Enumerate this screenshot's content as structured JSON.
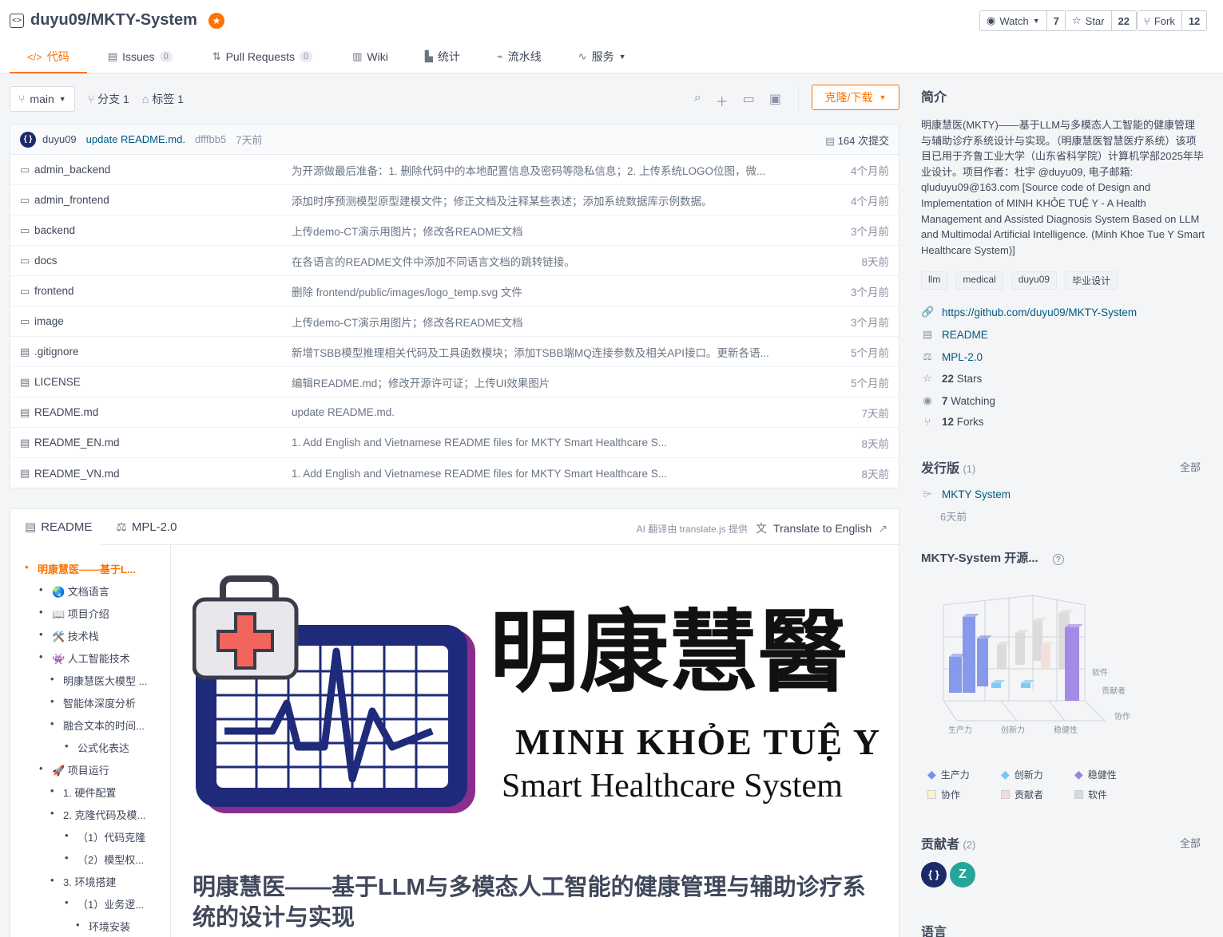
{
  "repo": {
    "title": "duyu09/MKTY-System"
  },
  "actions": {
    "watch_label": "Watch",
    "watch_count": "7",
    "star_label": "Star",
    "star_count": "22",
    "fork_label": "Fork",
    "fork_count": "12"
  },
  "tabs": [
    {
      "label": "代码",
      "icon": "code-icon"
    },
    {
      "label": "Issues",
      "icon": "issues-icon",
      "count": "0"
    },
    {
      "label": "Pull Requests",
      "icon": "pull-request-icon",
      "count": "0"
    },
    {
      "label": "Wiki",
      "icon": "wiki-icon"
    },
    {
      "label": "统计",
      "icon": "chart-icon"
    },
    {
      "label": "流水线",
      "icon": "pipeline-icon"
    },
    {
      "label": "服务",
      "icon": "service-icon"
    }
  ],
  "branchbar": {
    "branch": "main",
    "branches": "分支 1",
    "tags": "标签 1",
    "clone": "克隆/下载"
  },
  "commit": {
    "author": "duyu09",
    "message": "update README.md.",
    "sha": "dfffbb5",
    "time": "7天前",
    "total": "164 次提交"
  },
  "files": [
    {
      "name": "admin_backend",
      "type": "folder",
      "message": "为开源做最后准备：1. 删除代码中的本地配置信息及密码等隐私信息；2. 上传系统LOGO位图，微...",
      "time": "4个月前"
    },
    {
      "name": "admin_frontend",
      "type": "folder",
      "message": "添加时序预测模型原型建模文件；修正文档及注释某些表述；添加系统数据库示例数据。",
      "time": "4个月前"
    },
    {
      "name": "backend",
      "type": "folder",
      "message": "上传demo-CT演示用图片；修改各README文档",
      "time": "3个月前"
    },
    {
      "name": "docs",
      "type": "folder",
      "message": "在各语言的README文件中添加不同语言文档的跳转链接。",
      "time": "8天前"
    },
    {
      "name": "frontend",
      "type": "folder",
      "message": "删除 frontend/public/images/logo_temp.svg 文件",
      "time": "3个月前"
    },
    {
      "name": "image",
      "type": "folder",
      "message": "上传demo-CT演示用图片；修改各README文档",
      "time": "3个月前"
    },
    {
      "name": ".gitignore",
      "type": "file",
      "message": "新增TSBB模型推理相关代码及工具函数模块；添加TSBB端MQ连接参数及相关API接口。更新各语...",
      "time": "5个月前"
    },
    {
      "name": "LICENSE",
      "type": "file",
      "message": "编辑README.md；修改开源许可证；上传UI效果图片",
      "time": "5个月前"
    },
    {
      "name": "README.md",
      "type": "file",
      "message": "update README.md.",
      "time": "7天前"
    },
    {
      "name": "README_EN.md",
      "type": "file",
      "message": "1. Add English and Vietnamese README files for MKTY Smart Healthcare S...",
      "time": "8天前"
    },
    {
      "name": "README_VN.md",
      "type": "file",
      "message": "1. Add English and Vietnamese README files for MKTY Smart Healthcare S...",
      "time": "8天前"
    }
  ],
  "readme": {
    "tab_readme": "README",
    "tab_license": "MPL-2.0",
    "ai_note": "AI 翻译由 translate.js 提供",
    "translate": "Translate to English",
    "logo_cn": "明康慧醫",
    "logo_vn": "MINH KHỎE TUỆ Y",
    "logo_en": "Smart Healthcare System",
    "heading": "明康慧医——基于LLM与多模态人工智能的健康管理与辅助诊疗系统的设计与实现",
    "toc": [
      {
        "label": "明康慧医——基于L...",
        "level": 0
      },
      {
        "label": "🌏 文档语言",
        "level": 1
      },
      {
        "label": "📖 项目介绍",
        "level": 1
      },
      {
        "label": "🛠️ 技术栈",
        "level": 1
      },
      {
        "label": "👾 人工智能技术",
        "level": 1
      },
      {
        "label": "明康慧医大模型 ...",
        "level": 2
      },
      {
        "label": "智能体深度分析",
        "level": 2
      },
      {
        "label": "融合文本的时间...",
        "level": 2
      },
      {
        "label": "公式化表达",
        "level": 3
      },
      {
        "label": "🚀 项目运行",
        "level": 1
      },
      {
        "label": "1. 硬件配置",
        "level": 2
      },
      {
        "label": "2. 克隆代码及模...",
        "level": 2
      },
      {
        "label": "（1）代码克隆",
        "level": 3
      },
      {
        "label": "（2）模型权...",
        "level": 3
      },
      {
        "label": "3. 环境搭建",
        "level": 2
      },
      {
        "label": "（1）业务逻...",
        "level": 3
      },
      {
        "label": "环境安装",
        "level": 4
      }
    ]
  },
  "sidebar": {
    "intro_title": "简介",
    "description": "明康慧医(MKTY)——基于LLM与多模态人工智能的健康管理与辅助诊疗系统设计与实现。（明康慧医智慧医疗系统）该项目已用于齐鲁工业大学（山东省科学院）计算机学部2025年毕业设计。项目作者：杜宇 @duyu09, 电子邮箱: qluduyu09@163.com [Source code of Design and Implementation of MINH KHỎE TUỆ Y - A Health Management and Assisted Diagnosis System Based on LLM and Multimodal Artificial Intelligence. (Minh Khoe Tue Y Smart Healthcare System)]",
    "topics": [
      "llm",
      "medical",
      "duyu09",
      "毕业设计"
    ],
    "link": "https://github.com/duyu09/MKTY-System",
    "readme": "README",
    "license": "MPL-2.0",
    "stars_num": "22",
    "stars_label": "Stars",
    "watching_num": "7",
    "watching_label": "Watching",
    "forks_num": "12",
    "forks_label": "Forks",
    "release_title": "发行版",
    "release_count": "(1)",
    "all": "全部",
    "release_name": "MKTY System",
    "release_time": "6天前",
    "eval_title": "MKTY-System 开源...",
    "contrib_title": "贡献者",
    "contrib_count": "(2)",
    "lang_title": "语言"
  },
  "chart_data": {
    "type": "bar3d",
    "x_categories": [
      "生产力",
      "创新力",
      "稳健性"
    ],
    "z_categories": [
      "协作",
      "贡献者",
      "软件"
    ],
    "legend": [
      "生产力",
      "创新力",
      "稳健性",
      "协作",
      "贡献者",
      "软件"
    ],
    "colors": {
      "生产力": "#7b8fe8",
      "创新力": "#6fc8f0",
      "稳健性": "#9b7fe6",
      "协作": "#fdf3c6",
      "贡献者": "#f4ddd6",
      "软件": "#d9d9d9"
    }
  },
  "contributors": [
    {
      "initial": "{ }",
      "color": "#1c2a6a"
    },
    {
      "initial": "Z",
      "color": "#26a69a"
    }
  ]
}
